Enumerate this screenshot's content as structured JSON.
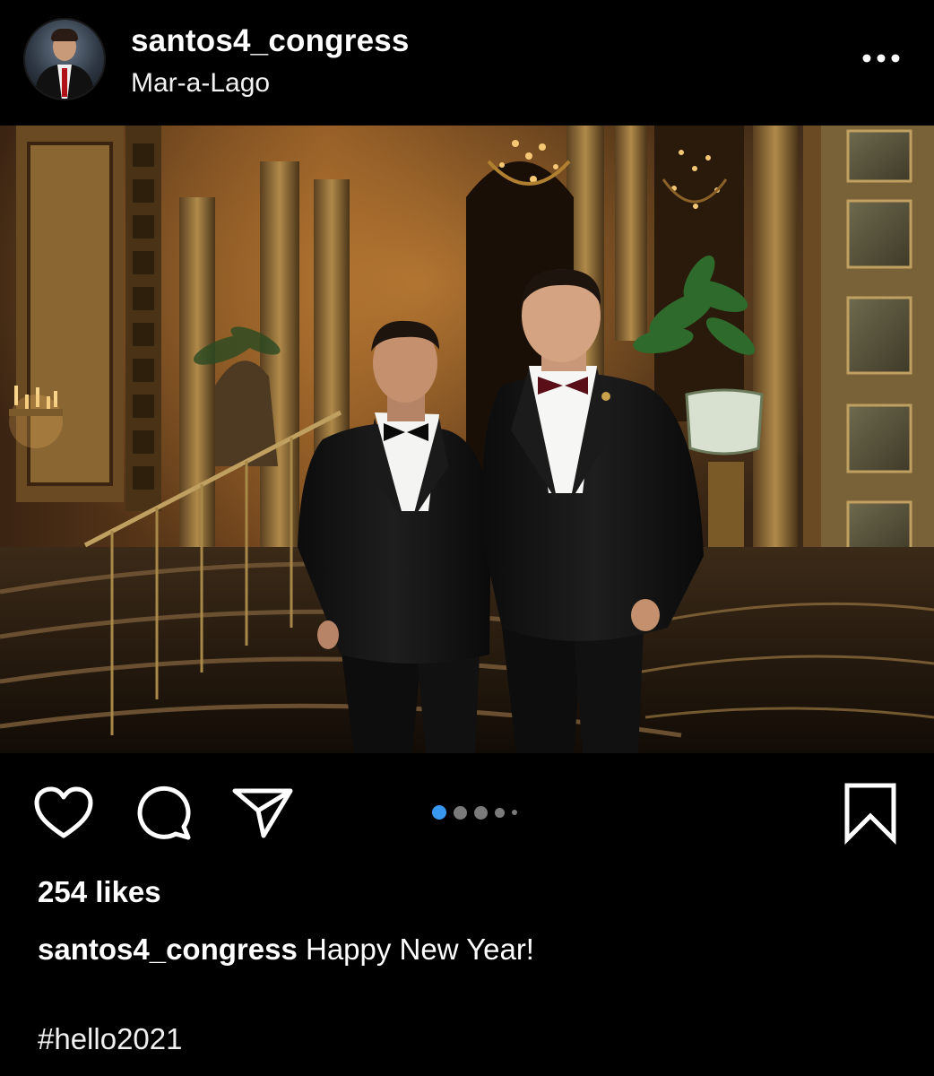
{
  "post": {
    "username": "santos4_congress",
    "location": "Mar-a-Lago",
    "more_icon": "more-horizontal-icon"
  },
  "actions": {
    "like_icon": "heart-icon",
    "comment_icon": "comment-icon",
    "share_icon": "send-icon",
    "save_icon": "bookmark-icon"
  },
  "carousel": {
    "total_indicators": 5,
    "active_index": 0,
    "active_color": "#3897f0",
    "inactive_color": "#7a7a7a"
  },
  "stats": {
    "likes": "254 likes"
  },
  "caption": {
    "username": "santos4_congress",
    "text": "Happy New Year!",
    "hashtag": "#hello2021"
  },
  "colors": {
    "background": "#000000",
    "text": "#ffffff"
  }
}
